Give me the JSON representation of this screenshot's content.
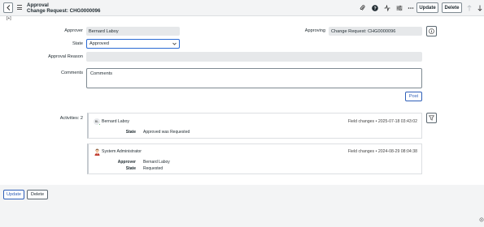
{
  "header": {
    "title_line1": "Approval",
    "title_line2": "Change Request: CHG0000096",
    "update_label": "Update",
    "delete_label": "Delete",
    "icons": [
      "paperclip-icon",
      "help-icon",
      "activity-pulse-icon",
      "settings-sliders-icon",
      "more-options-icon",
      "arrow-up-icon",
      "arrow-down-icon"
    ]
  },
  "collapse_toggle": "[+]",
  "form": {
    "approver_label": "Approver",
    "approver_value": "Bernard Laboy",
    "approving_label": "Approving",
    "approving_value": "Change Request: CHG0000096",
    "state_label": "State",
    "state_value": "Approved",
    "approval_reason_label": "Approval Reason",
    "approval_reason_value": "",
    "comments_label": "Comments",
    "comments_placeholder": "Comments",
    "post_label": "Post"
  },
  "activities": {
    "label": "Activities: 2",
    "items": [
      {
        "avatar_initials": "BL",
        "name": "Bernard Laboy",
        "meta": "Field changes  •  2025-07-18 03:43:02",
        "changes": [
          {
            "field": "State",
            "value": "Approved  was  Requested"
          }
        ]
      },
      {
        "avatar_initials": "",
        "name": "System Administrator",
        "meta": "Field changes  •  2024-08-29 08:04:38",
        "changes": [
          {
            "field": "Approver",
            "value": "Bernard Laboy"
          },
          {
            "field": "State",
            "value": "Requested"
          }
        ]
      }
    ]
  },
  "footer": {
    "update_label": "Update",
    "delete_label": "Delete"
  },
  "colors": {
    "accent": "#2f5fb8",
    "header_bg": "#f3f4f5",
    "field_bg": "#e6e8ea",
    "presence_green": "#3caa4f"
  }
}
